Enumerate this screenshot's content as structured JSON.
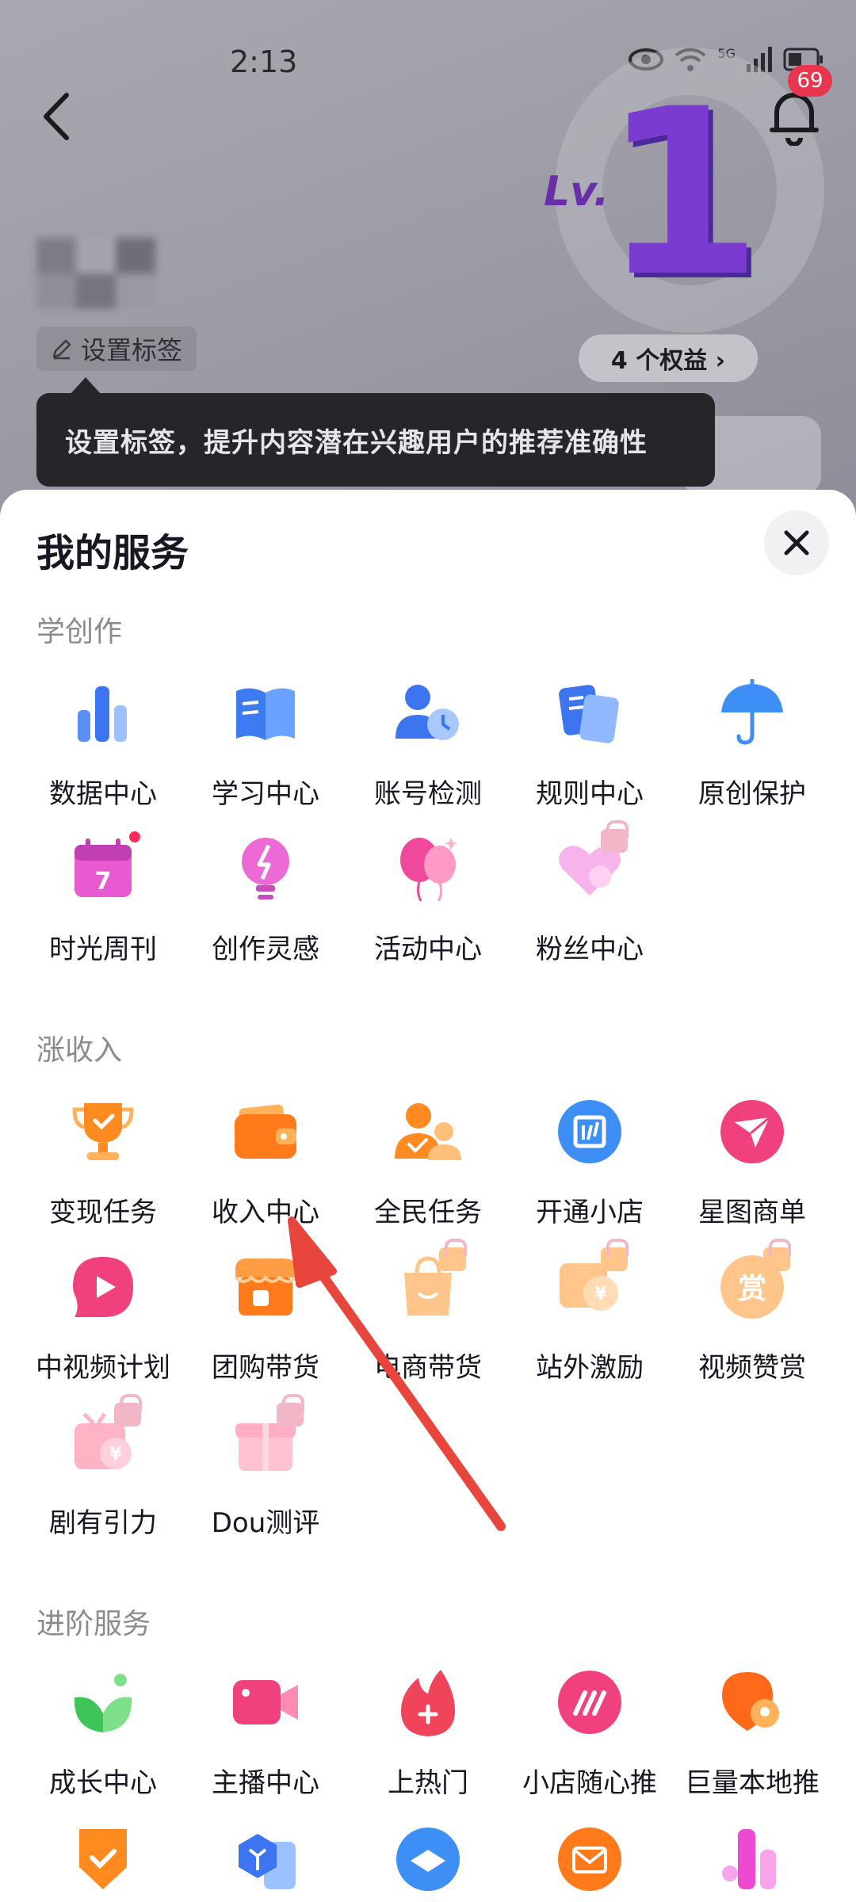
{
  "status_bar": {
    "time": "2:13",
    "network": "5G"
  },
  "header": {
    "notification_count": "69"
  },
  "profile": {
    "set_tag_label": "设置标签",
    "level_text": "Lv.",
    "level_number": "1",
    "benefits_label": "4 个权益 ›"
  },
  "tooltip": {
    "text": "设置标签，提升内容潜在兴趣用户的推荐准确性"
  },
  "sheet": {
    "title": "我的服务",
    "sections": [
      {
        "title": "学创作",
        "items": [
          "数据中心",
          "学习中心",
          "账号检测",
          "规则中心",
          "原创保护",
          "时光周刊",
          "创作灵感",
          "活动中心",
          "粉丝中心"
        ]
      },
      {
        "title": "涨收入",
        "items": [
          "变现任务",
          "收入中心",
          "全民任务",
          "开通小店",
          "星图商单",
          "中视频计划",
          "团购带货",
          "电商带货",
          "站外激励",
          "视频赞赏",
          "剧有引力",
          "Dou测评"
        ]
      },
      {
        "title": "进阶服务",
        "items": [
          "成长中心",
          "主播中心",
          "上热门",
          "小店随心推",
          "巨量本地推"
        ]
      }
    ]
  },
  "colors": {
    "accent_red": "#fe2c55",
    "annotation_arrow": "#e8463d",
    "tooltip_bg": "#25252a"
  }
}
